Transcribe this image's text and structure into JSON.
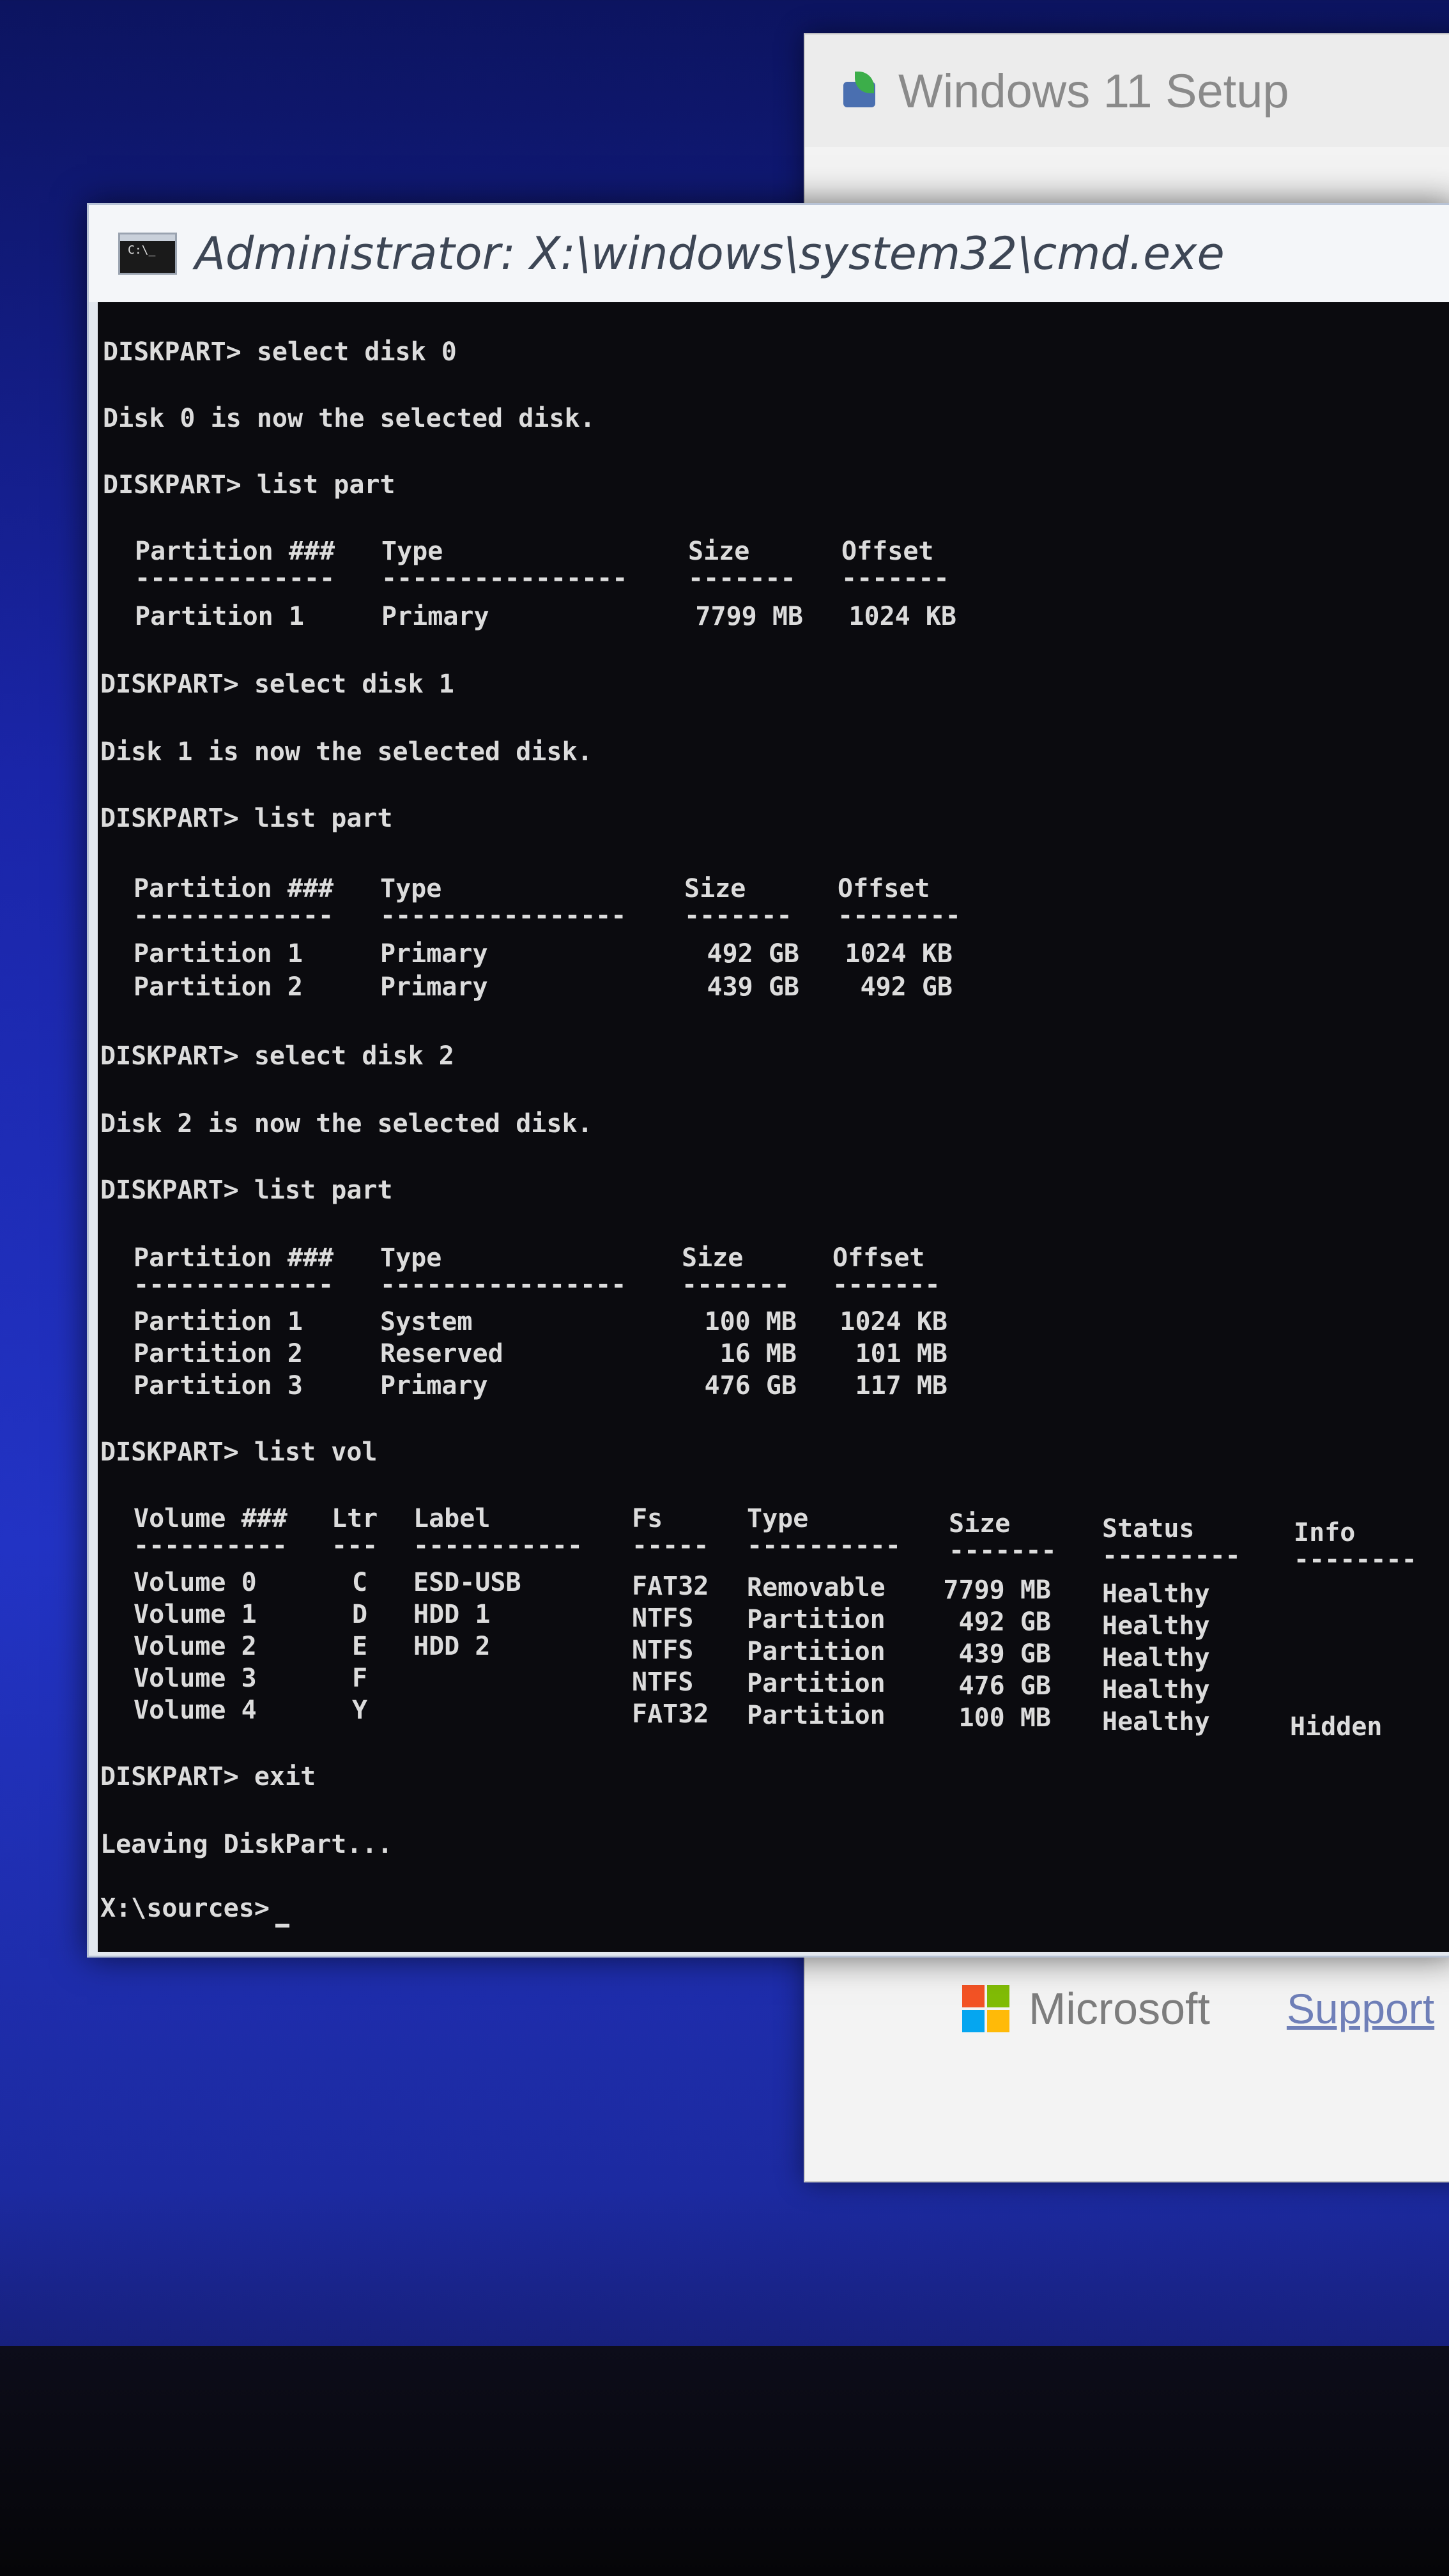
{
  "setup_window": {
    "title": "Windows 11 Setup",
    "footer_brand": "Microsoft",
    "footer_link": "Support"
  },
  "cmd_window": {
    "title": "Administrator: X:\\windows\\system32\\cmd.exe",
    "icon_text": "C:\\_"
  },
  "console": {
    "cmd1": "DISKPART> select disk 0",
    "msg1": "Disk 0 is now the selected disk.",
    "cmd2": "DISKPART> list part",
    "part_headers": [
      "Partition ###",
      "Type",
      "Size",
      "Offset"
    ],
    "part_sep": [
      "-------------",
      "----------------",
      "-------",
      "-------"
    ],
    "part_sep2": [
      "-------------",
      "----------------",
      "-------",
      "--------"
    ],
    "disk0_parts": [
      [
        "Partition 1",
        "Primary",
        "7799 MB",
        "1024 KB"
      ]
    ],
    "cmd3": "DISKPART> select disk 1",
    "msg3": "Disk 1 is now the selected disk.",
    "cmd4": "DISKPART> list part",
    "disk1_parts": [
      [
        "Partition 1",
        "Primary",
        "492 GB",
        "1024 KB"
      ],
      [
        "Partition 2",
        "Primary",
        "439 GB",
        "492 GB"
      ]
    ],
    "cmd5": "DISKPART> select disk 2",
    "msg5": "Disk 2 is now the selected disk.",
    "cmd6": "DISKPART> list part",
    "disk2_parts": [
      [
        "Partition 1",
        "System",
        "100 MB",
        "1024 KB"
      ],
      [
        "Partition 2",
        "Reserved",
        "16 MB",
        "101 MB"
      ],
      [
        "Partition 3",
        "Primary",
        "476 GB",
        "117 MB"
      ]
    ],
    "cmd7": "DISKPART> list vol",
    "vol_headers": [
      "Volume ###",
      "Ltr",
      "Label",
      "Fs",
      "Type",
      "Size",
      "Status",
      "Info"
    ],
    "vol_sep": [
      "----------",
      "---",
      "-----------",
      "-----",
      "----------",
      "-------",
      "---------",
      "--------"
    ],
    "volumes": [
      [
        "Volume 0",
        "C",
        "ESD-USB",
        "FAT32",
        "Removable",
        "7799 MB",
        "Healthy",
        ""
      ],
      [
        "Volume 1",
        "D",
        "HDD 1",
        "NTFS",
        "Partition",
        "492 GB",
        "Healthy",
        ""
      ],
      [
        "Volume 2",
        "E",
        "HDD 2",
        "NTFS",
        "Partition",
        "439 GB",
        "Healthy",
        ""
      ],
      [
        "Volume 3",
        "F",
        "",
        "NTFS",
        "Partition",
        "476 GB",
        "Healthy",
        ""
      ],
      [
        "Volume 4",
        "Y",
        "",
        "FAT32",
        "Partition",
        "100 MB",
        "Healthy",
        "Hidden"
      ]
    ],
    "cmd8": "DISKPART> exit",
    "msg8": "Leaving DiskPart...",
    "prompt": "X:\\sources>"
  }
}
